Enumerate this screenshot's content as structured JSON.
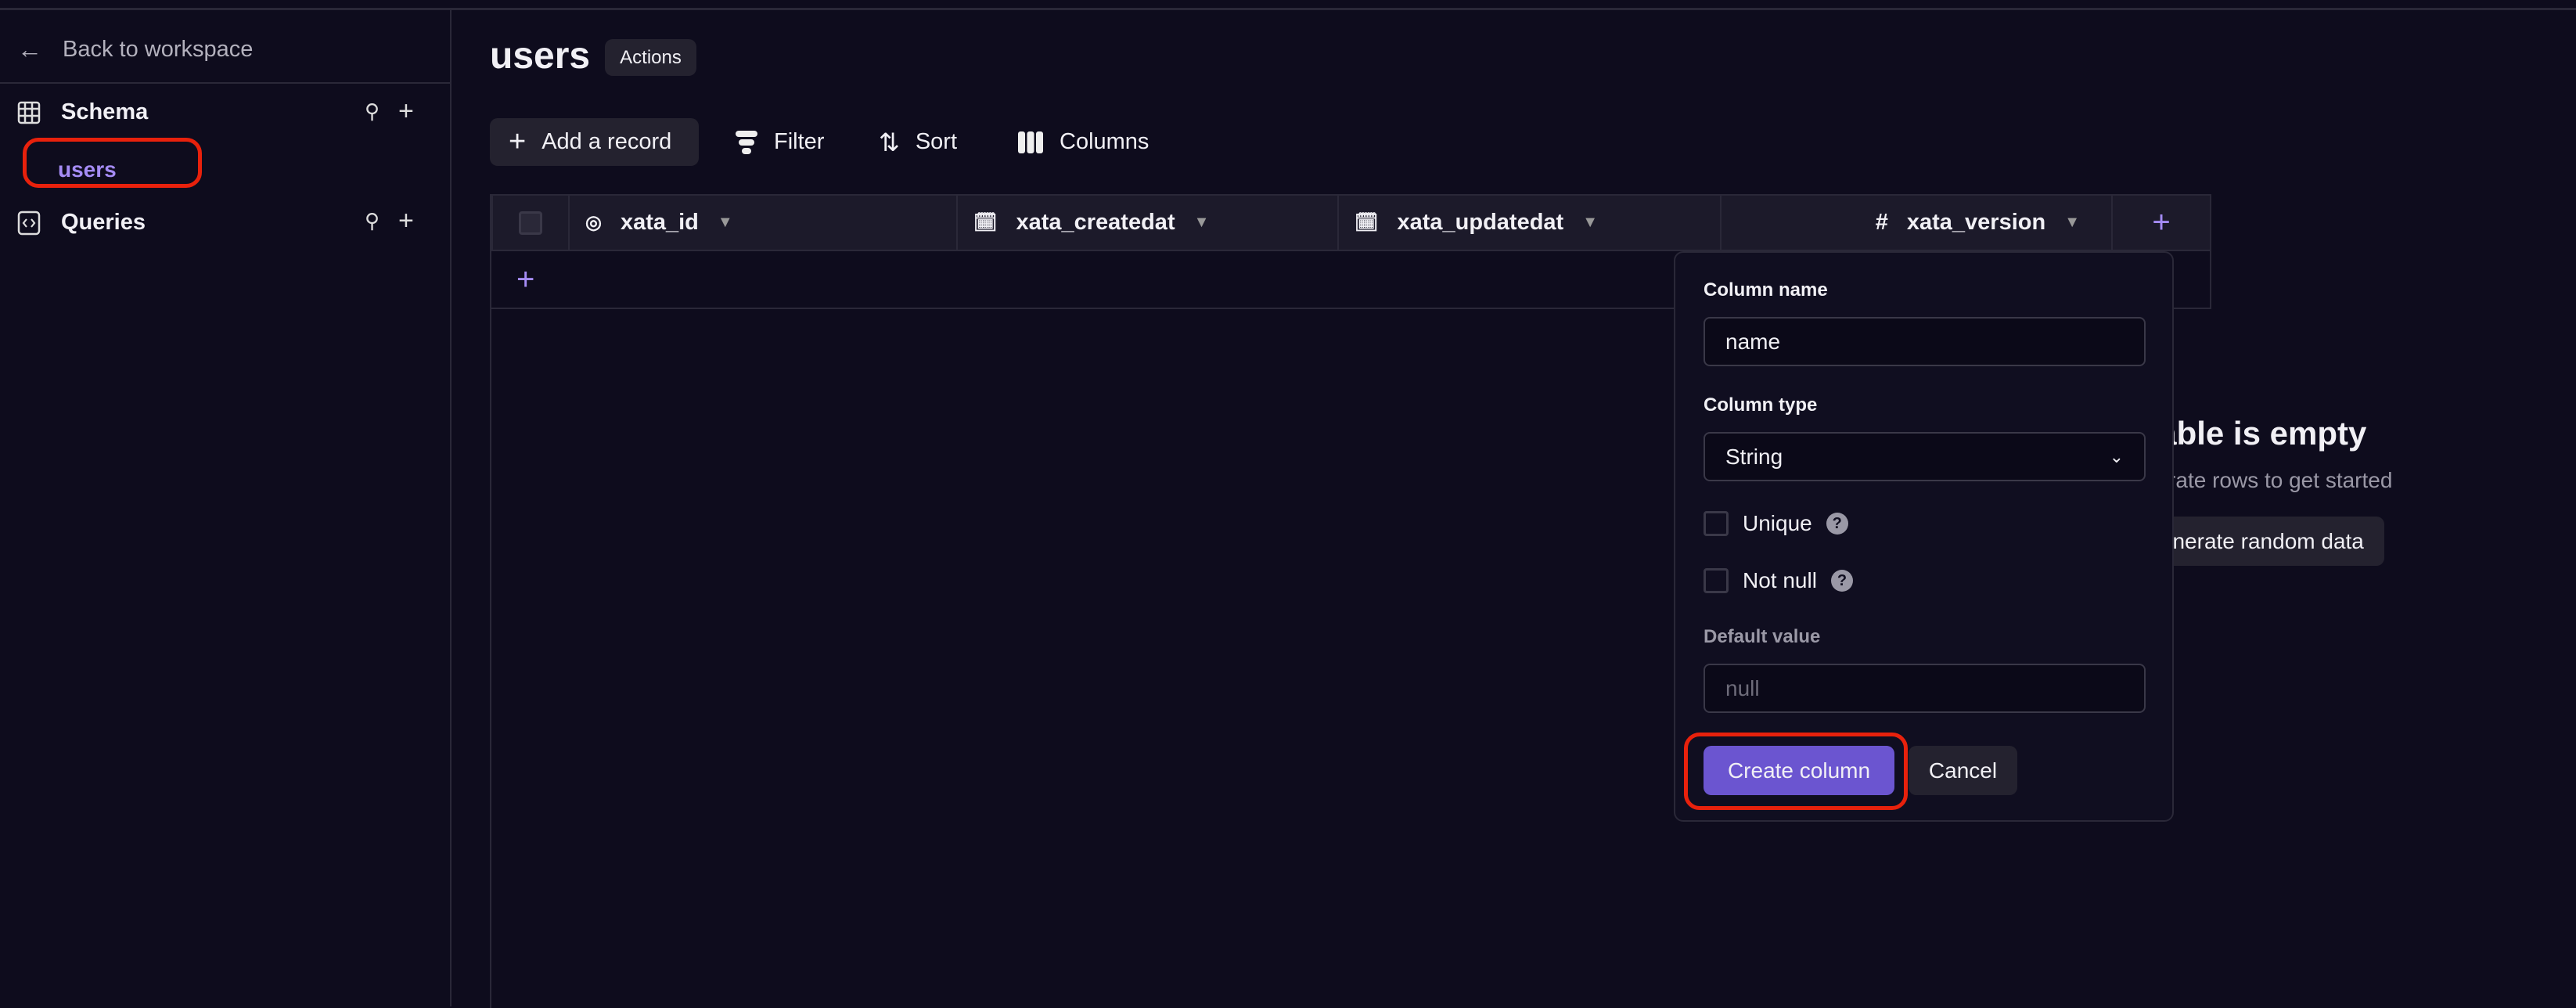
{
  "sidebar": {
    "back_label": "Back to workspace",
    "schema_label": "Schema",
    "tables": [
      "users"
    ],
    "queries_label": "Queries"
  },
  "header": {
    "title": "users",
    "actions_label": "Actions"
  },
  "toolbar": {
    "add_record": "Add a record",
    "filter": "Filter",
    "sort": "Sort",
    "columns": "Columns"
  },
  "table": {
    "columns": [
      {
        "name": "xata_id",
        "icon": "fingerprint-icon"
      },
      {
        "name": "xata_createdat",
        "icon": "calendar-clock-icon"
      },
      {
        "name": "xata_updatedat",
        "icon": "calendar-clock-icon"
      },
      {
        "name": "xata_version",
        "icon": "hash-icon"
      }
    ]
  },
  "empty_state": {
    "title": "Table is empty",
    "subtitle": "Generate rows to get started",
    "button": "Generate random data"
  },
  "popover": {
    "column_name_label": "Column name",
    "column_name_value": "name",
    "column_type_label": "Column type",
    "column_type_value": "String",
    "unique_label": "Unique",
    "not_null_label": "Not null",
    "default_value_label": "Default value",
    "default_value_placeholder": "null",
    "create_button": "Create column",
    "cancel_button": "Cancel"
  },
  "colors": {
    "accent": "#6b55d0",
    "accent_text": "#a58cf5",
    "highlight": "#e8210c",
    "background": "#0e0c1d"
  }
}
